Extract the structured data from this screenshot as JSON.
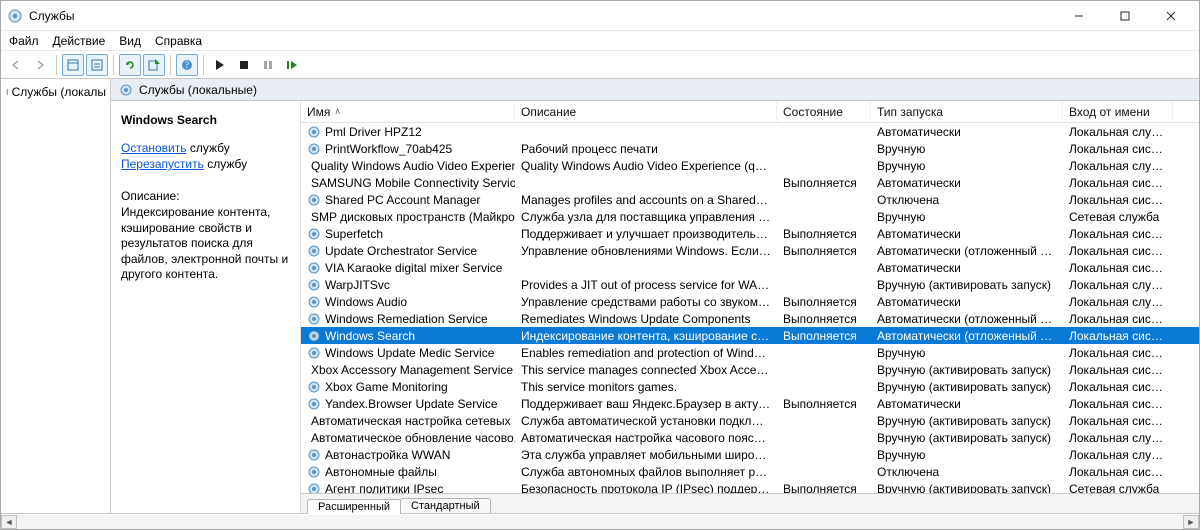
{
  "window": {
    "title": "Службы"
  },
  "menu": [
    "Файл",
    "Действие",
    "Вид",
    "Справка"
  ],
  "tree": {
    "item": "Службы (локалы"
  },
  "nodebar": {
    "label": "Службы (локальные)"
  },
  "detail": {
    "heading": "Windows Search",
    "link_stop": "Остановить",
    "link_stop_suffix": " службу",
    "link_restart": "Перезапустить",
    "link_restart_suffix": " службу",
    "desc_label": "Описание:",
    "desc_text": "Индексирование контента, кэширование свойств и результатов поиска для файлов, электронной почты и другого контента."
  },
  "columns": {
    "name": "Имя",
    "desc": "Описание",
    "state": "Состояние",
    "startup": "Тип запуска",
    "logon": "Вход от имени"
  },
  "services": [
    {
      "name": "Pml Driver HPZ12",
      "desc": "",
      "state": "",
      "startup": "Автоматически",
      "logon": "Локальная служба"
    },
    {
      "name": "PrintWorkflow_70ab425",
      "desc": "Рабочий процесс печати",
      "state": "",
      "startup": "Вручную",
      "logon": "Локальная система"
    },
    {
      "name": "Quality Windows Audio Video Experience",
      "desc": "Quality Windows Audio Video Experience (qWave) - с...",
      "state": "",
      "startup": "Вручную",
      "logon": "Локальная служба"
    },
    {
      "name": "SAMSUNG Mobile Connectivity Service",
      "desc": "",
      "state": "Выполняется",
      "startup": "Автоматически",
      "logon": "Локальная система"
    },
    {
      "name": "Shared PC Account Manager",
      "desc": "Manages profiles and accounts on a SharedPC config...",
      "state": "",
      "startup": "Отключена",
      "logon": "Локальная система"
    },
    {
      "name": "SMP дисковых пространств (Майкрос...",
      "desc": "Служба узла для поставщика управления дисковы...",
      "state": "",
      "startup": "Вручную",
      "logon": "Сетевая служба"
    },
    {
      "name": "Superfetch",
      "desc": "Поддерживает и улучшает производительность си...",
      "state": "Выполняется",
      "startup": "Автоматически",
      "logon": "Локальная система"
    },
    {
      "name": "Update Orchestrator Service",
      "desc": "Управление обновлениями Windows. Если она оста...",
      "state": "Выполняется",
      "startup": "Автоматически (отложенный запуск)",
      "logon": "Локальная система"
    },
    {
      "name": "VIA Karaoke digital mixer Service",
      "desc": "",
      "state": "",
      "startup": "Автоматически",
      "logon": "Локальная система"
    },
    {
      "name": "WarpJITSvc",
      "desc": "Provides a JIT out of process service for WARP when r...",
      "state": "",
      "startup": "Вручную (активировать запуск)",
      "logon": "Локальная служба"
    },
    {
      "name": "Windows Audio",
      "desc": "Управление средствами работы со звуком для про...",
      "state": "Выполняется",
      "startup": "Автоматически",
      "logon": "Локальная служба"
    },
    {
      "name": "Windows Remediation Service",
      "desc": "Remediates Windows Update Components",
      "state": "Выполняется",
      "startup": "Автоматически (отложенный запуск)",
      "logon": "Локальная система"
    },
    {
      "name": "Windows Search",
      "desc": "Индексирование контента, кэширование свойств ...",
      "state": "Выполняется",
      "startup": "Автоматически (отложенный запуск)",
      "logon": "Локальная система",
      "selected": true
    },
    {
      "name": "Windows Update Medic Service",
      "desc": "Enables remediation and protection of Windows Upd...",
      "state": "",
      "startup": "Вручную",
      "logon": "Локальная система"
    },
    {
      "name": "Xbox Accessory Management Service",
      "desc": "This service manages connected Xbox Accessories.",
      "state": "",
      "startup": "Вручную (активировать запуск)",
      "logon": "Локальная система"
    },
    {
      "name": "Xbox Game Monitoring",
      "desc": "This service monitors games.",
      "state": "",
      "startup": "Вручную (активировать запуск)",
      "logon": "Локальная система"
    },
    {
      "name": "Yandex.Browser Update Service",
      "desc": "Поддерживает ваш Яндекс.Браузер в актуальном с...",
      "state": "Выполняется",
      "startup": "Автоматически",
      "logon": "Локальная система"
    },
    {
      "name": "Автоматическая настройка сетевых ...",
      "desc": "Служба автоматической установки подключений ...",
      "state": "",
      "startup": "Вручную (активировать запуск)",
      "logon": "Локальная система"
    },
    {
      "name": "Автоматическое обновление часово...",
      "desc": "Автоматическая настройка часового пояса для си...",
      "state": "",
      "startup": "Вручную (активировать запуск)",
      "logon": "Локальная служба"
    },
    {
      "name": "Автонастройка WWAN",
      "desc": "Эта служба управляет мобильными широкополос...",
      "state": "",
      "startup": "Вручную",
      "logon": "Локальная служба"
    },
    {
      "name": "Автономные файлы",
      "desc": "Служба автономных файлов выполняет работу по...",
      "state": "",
      "startup": "Отключена",
      "logon": "Локальная система"
    },
    {
      "name": "Агент политики IPsec",
      "desc": "Безопасность протокола IP (IPsec) поддерживает п...",
      "state": "Выполняется",
      "startup": "Вручную (активировать запуск)",
      "logon": "Сетевая служба"
    }
  ],
  "tabs": {
    "extended": "Расширенный",
    "standard": "Стандартный"
  }
}
